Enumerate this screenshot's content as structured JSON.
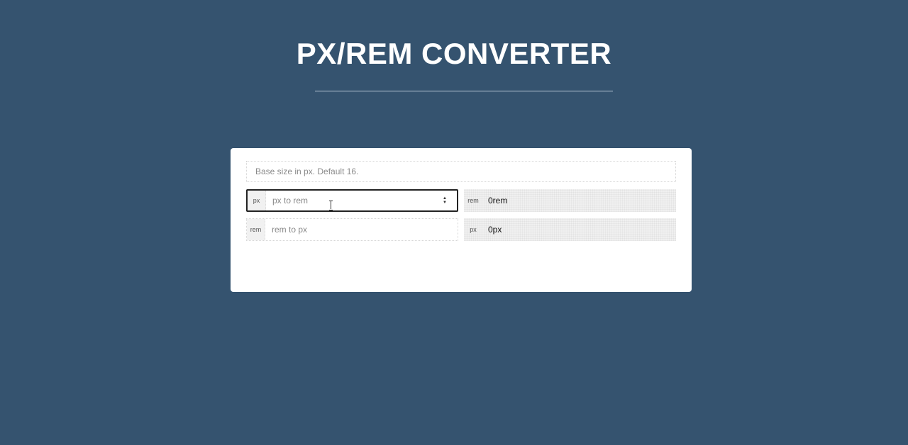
{
  "header": {
    "title": "PX/REM CONVERTER"
  },
  "converter": {
    "base_size": {
      "placeholder": "Base size in px. Default 16."
    },
    "px_to_rem": {
      "unit_label": "px",
      "placeholder": "px to rem",
      "result_unit": "rem",
      "result_value": "0rem"
    },
    "rem_to_px": {
      "unit_label": "rem",
      "placeholder": "rem to px",
      "result_unit": "px",
      "result_value": "0px"
    }
  },
  "icons": {
    "stepper": "up-down-arrows-icon",
    "cursor": "text-cursor-icon"
  },
  "colors": {
    "background": "#35536f",
    "card": "#ffffff",
    "title": "#ffffff",
    "active_border": "#222222"
  }
}
